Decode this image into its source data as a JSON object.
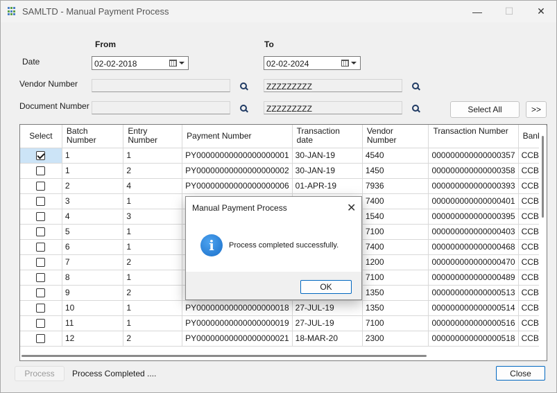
{
  "window": {
    "title": "SAMLTD - Manual Payment Process",
    "controls": {
      "minimize": "—",
      "maximize": "☐",
      "close": "✕"
    }
  },
  "filters": {
    "from_label": "From",
    "to_label": "To",
    "date_label": "Date",
    "date_from": "02-02-2018",
    "date_to": "02-02-2024",
    "vendor_label": "Vendor Number",
    "vendor_from": "",
    "vendor_to": "ZZZZZZZZZ",
    "document_label": "Document Number",
    "document_from": "",
    "document_to": "ZZZZZZZZZ",
    "select_all_label": "Select All",
    "more_label": ">>"
  },
  "grid": {
    "columns": [
      "Select",
      "Batch Number",
      "Entry Number",
      "Payment Number",
      "Transaction date",
      "Vendor Number",
      "Transaction Number",
      "Bank"
    ],
    "rows": [
      {
        "checked": true,
        "batch": "1",
        "entry": "1",
        "payment": "PY00000000000000000001",
        "date": "30-JAN-19",
        "vendor": "4540",
        "txn": "000000000000000357",
        "bank": "CCB"
      },
      {
        "checked": false,
        "batch": "1",
        "entry": "2",
        "payment": "PY00000000000000000002",
        "date": "30-JAN-19",
        "vendor": "1450",
        "txn": "000000000000000358",
        "bank": "CCB"
      },
      {
        "checked": false,
        "batch": "2",
        "entry": "4",
        "payment": "PY00000000000000000006",
        "date": "01-APR-19",
        "vendor": "7936",
        "txn": "000000000000000393",
        "bank": "CCB"
      },
      {
        "checked": false,
        "batch": "3",
        "entry": "1",
        "payment": "",
        "date": "",
        "vendor": "7400",
        "txn": "000000000000000401",
        "bank": "CCB"
      },
      {
        "checked": false,
        "batch": "4",
        "entry": "3",
        "payment": "",
        "date": "",
        "vendor": "1540",
        "txn": "000000000000000395",
        "bank": "CCB"
      },
      {
        "checked": false,
        "batch": "5",
        "entry": "1",
        "payment": "",
        "date": "",
        "vendor": "7100",
        "txn": "000000000000000403",
        "bank": "CCB"
      },
      {
        "checked": false,
        "batch": "6",
        "entry": "1",
        "payment": "",
        "date": "",
        "vendor": "7400",
        "txn": "000000000000000468",
        "bank": "CCB"
      },
      {
        "checked": false,
        "batch": "7",
        "entry": "2",
        "payment": "",
        "date": "",
        "vendor": "1200",
        "txn": "000000000000000470",
        "bank": "CCB"
      },
      {
        "checked": false,
        "batch": "8",
        "entry": "1",
        "payment": "",
        "date": "",
        "vendor": "7100",
        "txn": "000000000000000489",
        "bank": "CCB"
      },
      {
        "checked": false,
        "batch": "9",
        "entry": "2",
        "payment": "",
        "date": "",
        "vendor": "1350",
        "txn": "000000000000000513",
        "bank": "CCB"
      },
      {
        "checked": false,
        "batch": "10",
        "entry": "1",
        "payment": "PY00000000000000000018",
        "date": "27-JUL-19",
        "vendor": "1350",
        "txn": "000000000000000514",
        "bank": "CCB"
      },
      {
        "checked": false,
        "batch": "11",
        "entry": "1",
        "payment": "PY00000000000000000019",
        "date": "27-JUL-19",
        "vendor": "7100",
        "txn": "000000000000000516",
        "bank": "CCB"
      },
      {
        "checked": false,
        "batch": "12",
        "entry": "2",
        "payment": "PY00000000000000000021",
        "date": "18-MAR-20",
        "vendor": "2300",
        "txn": "000000000000000518",
        "bank": "CCB"
      }
    ]
  },
  "footer": {
    "process_label": "Process",
    "status_text": "Process Completed ....",
    "close_label": "Close"
  },
  "dialog": {
    "title": "Manual Payment Process",
    "close_glyph": "✕",
    "icon_glyph": "i",
    "message": "Process completed successfully.",
    "ok_label": "OK"
  }
}
